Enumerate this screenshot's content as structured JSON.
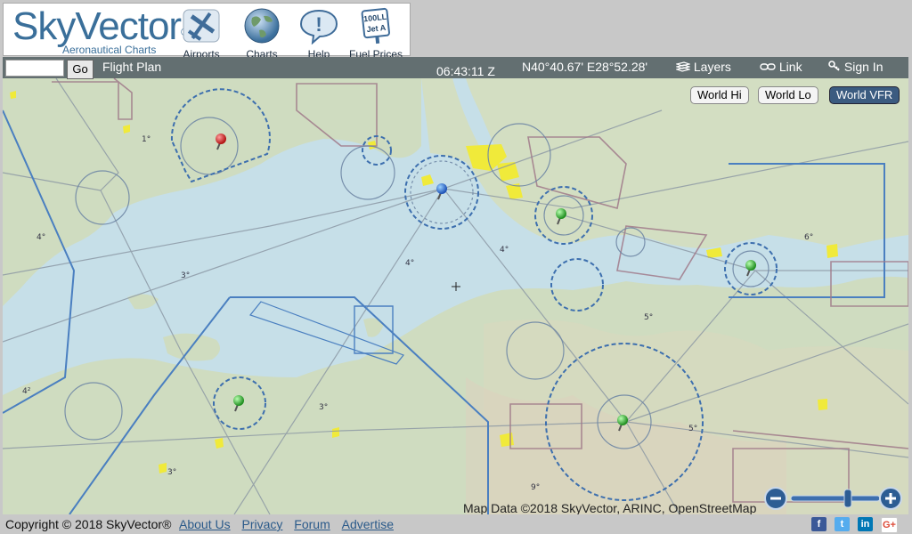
{
  "logo": {
    "text": "SkyVector",
    "mark": "®",
    "subtitle": "Aeronautical Charts"
  },
  "nav": [
    {
      "label": "Airports",
      "icon": "airport-plane-icon"
    },
    {
      "label": "Charts",
      "icon": "globe-icon"
    },
    {
      "label": "Help",
      "icon": "help-bubble-icon"
    },
    {
      "label": "Fuel Prices",
      "icon": "fuel-sign-icon",
      "sign_line1": "100LL",
      "sign_line2": "Jet A"
    }
  ],
  "toolbar": {
    "search_placeholder": "",
    "go_label": "Go",
    "flight_plan_label": "Flight Plan",
    "time": "06:43:11 Z",
    "coords": "N40°40.67' E28°52.28'",
    "layers_label": "Layers",
    "link_label": "Link",
    "signin_label": "Sign In"
  },
  "charts": {
    "options": [
      "World Hi",
      "World Lo",
      "World VFR"
    ],
    "selected": "World VFR"
  },
  "map": {
    "attribution": "Map Data ©2018 SkyVector, ARINC, OpenStreetMap",
    "labels": [
      "4°",
      "3°",
      "4°",
      "4°",
      "5°",
      "6°",
      "1°",
      "4²",
      "3°",
      "3°",
      "5°",
      "9°"
    ]
  },
  "footer": {
    "copyright": "Copyright © 2018 SkyVector®",
    "links": [
      "About Us",
      "Privacy",
      "Forum",
      "Advertise"
    ],
    "social": [
      "f",
      "t",
      "in",
      "G+"
    ]
  },
  "colors": {
    "brand": "#3a6f9a",
    "water": "#c6dfe8",
    "land": "#cfdcc0",
    "airspace": "#4a7fc0"
  }
}
